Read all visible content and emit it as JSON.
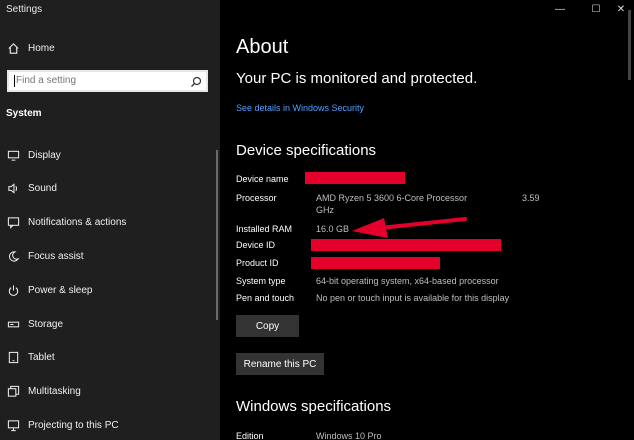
{
  "window": {
    "title": "Settings",
    "controls": [
      "—",
      "☐",
      "✕"
    ]
  },
  "sidebar": {
    "home_label": "Home",
    "search_placeholder": "Find a setting",
    "section_title": "System",
    "items": [
      {
        "label": "Display",
        "icon": "display-icon"
      },
      {
        "label": "Sound",
        "icon": "speaker-icon"
      },
      {
        "label": "Notifications & actions",
        "icon": "notification-icon"
      },
      {
        "label": "Focus assist",
        "icon": "moon-icon"
      },
      {
        "label": "Power & sleep",
        "icon": "power-icon"
      },
      {
        "label": "Storage",
        "icon": "storage-icon"
      },
      {
        "label": "Tablet",
        "icon": "tablet-icon"
      },
      {
        "label": "Multitasking",
        "icon": "multitasking-icon"
      },
      {
        "label": "Projecting to this PC",
        "icon": "projector-icon"
      }
    ]
  },
  "main": {
    "title": "About",
    "protection_text": "Your PC is monitored and protected.",
    "security_link": "See details in Windows Security",
    "device_specs_title": "Device specifications",
    "specs": {
      "device_name_label": "Device name",
      "processor_label": "Processor",
      "processor_value_line1": "AMD Ryzen 5 3600 6-Core Processor",
      "processor_value_line2": "GHz",
      "processor_speed": "3.59",
      "ram_label": "Installed RAM",
      "ram_value": "16.0 GB",
      "device_id_label": "Device ID",
      "product_id_label": "Product ID",
      "system_type_label": "System type",
      "system_type_value": "64-bit operating system, x64-based processor",
      "pen_touch_label": "Pen and touch",
      "pen_touch_value": "No pen or touch input is available for this display"
    },
    "copy_button": "Copy",
    "rename_button": "Rename this PC",
    "windows_specs_title": "Windows specifications",
    "edition_label": "Edition",
    "edition_value": "Windows 10 Pro"
  },
  "colors": {
    "redaction": "#e4002b",
    "link": "#4ea1ff",
    "arrow": "#e4002b"
  }
}
